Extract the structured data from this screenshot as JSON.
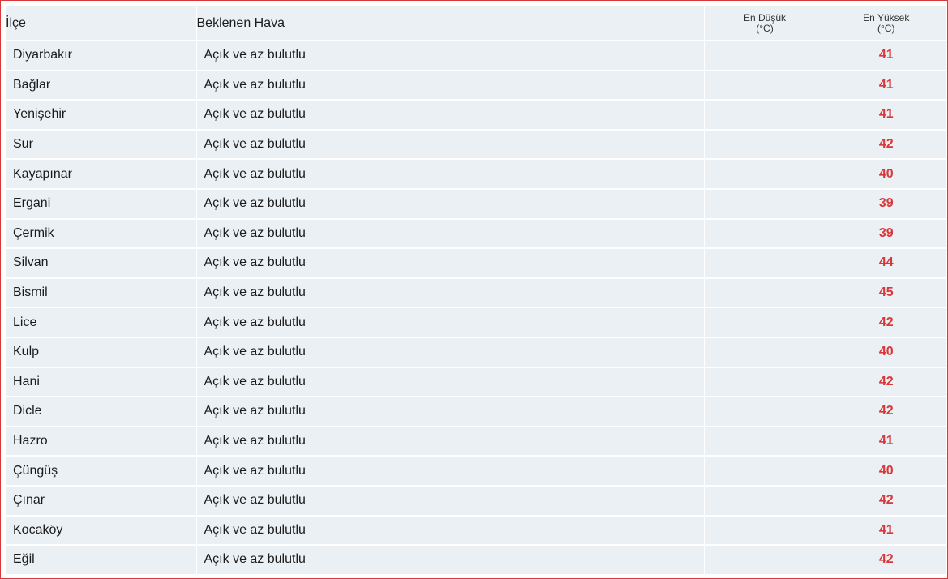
{
  "header": {
    "district": "İlçe",
    "expected_weather": "Beklenen Hava",
    "min_label": "En Düşük",
    "min_unit": "(°C)",
    "max_label": "En Yüksek",
    "max_unit": "(°C)"
  },
  "colors": {
    "border": "#d9383a",
    "row_bg": "#eaf0f4",
    "max_temp": "#d9383a"
  },
  "rows": [
    {
      "district": "Diyarbakır",
      "weather": "Açık ve az bulutlu",
      "min": "",
      "max": "41"
    },
    {
      "district": "Bağlar",
      "weather": "Açık ve az bulutlu",
      "min": "",
      "max": "41"
    },
    {
      "district": "Yenişehir",
      "weather": "Açık ve az bulutlu",
      "min": "",
      "max": "41"
    },
    {
      "district": "Sur",
      "weather": "Açık ve az bulutlu",
      "min": "",
      "max": "42"
    },
    {
      "district": "Kayapınar",
      "weather": "Açık ve az bulutlu",
      "min": "",
      "max": "40"
    },
    {
      "district": "Ergani",
      "weather": "Açık ve az bulutlu",
      "min": "",
      "max": "39"
    },
    {
      "district": "Çermik",
      "weather": "Açık ve az bulutlu",
      "min": "",
      "max": "39"
    },
    {
      "district": "Silvan",
      "weather": "Açık ve az bulutlu",
      "min": "",
      "max": "44"
    },
    {
      "district": "Bismil",
      "weather": "Açık ve az bulutlu",
      "min": "",
      "max": "45"
    },
    {
      "district": "Lice",
      "weather": "Açık ve az bulutlu",
      "min": "",
      "max": "42"
    },
    {
      "district": "Kulp",
      "weather": "Açık ve az bulutlu",
      "min": "",
      "max": "40"
    },
    {
      "district": "Hani",
      "weather": "Açık ve az bulutlu",
      "min": "",
      "max": "42"
    },
    {
      "district": "Dicle",
      "weather": "Açık ve az bulutlu",
      "min": "",
      "max": "42"
    },
    {
      "district": "Hazro",
      "weather": "Açık ve az bulutlu",
      "min": "",
      "max": "41"
    },
    {
      "district": "Çüngüş",
      "weather": "Açık ve az bulutlu",
      "min": "",
      "max": "40"
    },
    {
      "district": "Çınar",
      "weather": "Açık ve az bulutlu",
      "min": "",
      "max": "42"
    },
    {
      "district": "Kocaköy",
      "weather": "Açık ve az bulutlu",
      "min": "",
      "max": "41"
    },
    {
      "district": "Eğil",
      "weather": "Açık ve az bulutlu",
      "min": "",
      "max": "42"
    }
  ]
}
